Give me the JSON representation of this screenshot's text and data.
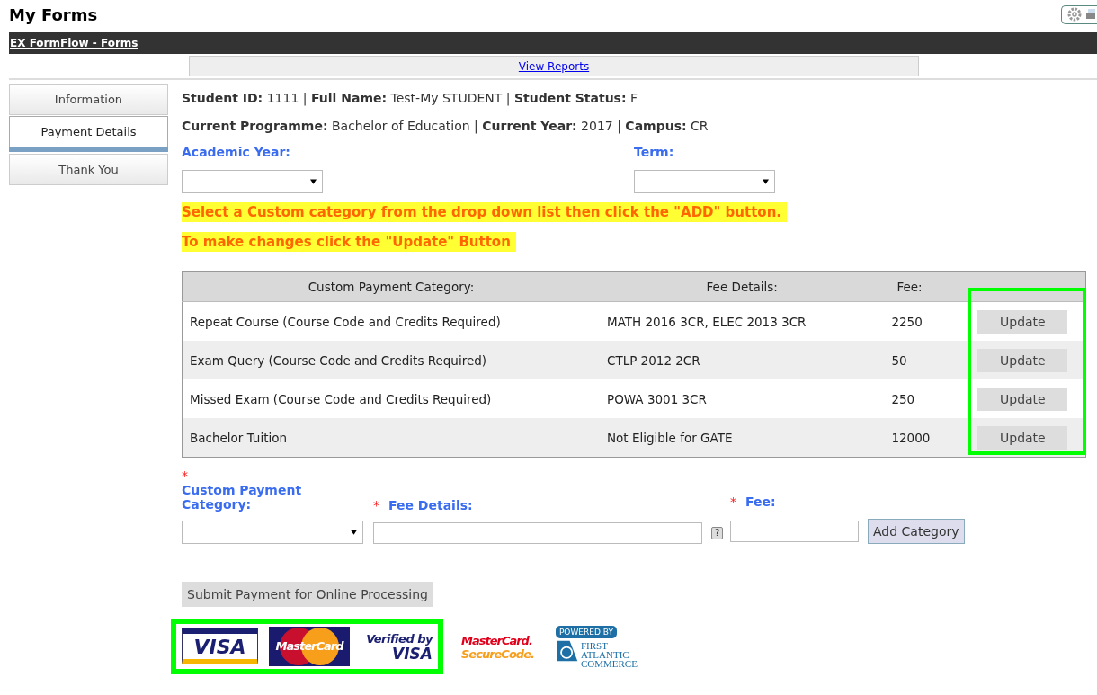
{
  "page_title": "My Forms",
  "nav_bar": {
    "link": "EX FormFlow - Forms"
  },
  "sub_bar": {
    "link": "View Reports"
  },
  "sidebar_tabs": [
    {
      "label": "Information",
      "selected": false
    },
    {
      "label": "Payment Details",
      "selected": true
    },
    {
      "label": "Thank You",
      "selected": false
    }
  ],
  "student_info": [
    "**Student ID:** 1111 | **Full Name:** Test-My STUDENT | **Student Status:** F",
    "**Current Programme:** Bachelor of Education | **Current Year:** 2017 | **Campus:** CR"
  ],
  "filters": [
    {
      "label": "Academic Year:"
    },
    {
      "label": "Term:"
    }
  ],
  "instructions": [
    "Select a Custom category from the drop down list then click the \"ADD\" button.",
    "To make changes click the \"Update\" Button"
  ],
  "table": {
    "columns": [
      "Custom Payment Category:",
      "Fee Details:",
      "Fee:"
    ],
    "rows": [
      {
        "category": "Repeat Course (Course Code and Credits Required)",
        "details": "MATH 2016 3CR, ELEC 2013 3CR",
        "fee": "2250",
        "action": "Update"
      },
      {
        "category": "Exam Query (Course Code and Credits Required)",
        "details": "CTLP 2012 2CR",
        "fee": "50",
        "action": "Update"
      },
      {
        "category": "Missed Exam (Course Code and Credits Required)",
        "details": "POWA 3001 3CR",
        "fee": "250",
        "action": "Update"
      },
      {
        "category": "Bachelor Tuition",
        "details": "Not Eligible for GATE",
        "fee": "12000",
        "action": "Update"
      }
    ]
  },
  "add_form": {
    "required_mark": "*",
    "category_label": "Custom Payment Category:",
    "details_label": "Fee Details:",
    "fee_label": "Fee:",
    "help": "?",
    "button": "Add Category"
  },
  "submit_button": "Submit Payment for Online Processing",
  "logos": [
    {
      "kind": "visa",
      "texts": [
        "VISA"
      ]
    },
    {
      "kind": "mastercard",
      "texts": [
        "MasterCard"
      ]
    },
    {
      "kind": "verified",
      "texts": [
        "Verified by",
        "VISA"
      ]
    },
    {
      "kind": "securecode",
      "texts": [
        "MasterCard.",
        "SecureCode."
      ]
    },
    {
      "kind": "fac",
      "texts": [
        "POWERED BY",
        "FIRST",
        "ATLANTIC",
        "COMMERCE"
      ]
    }
  ]
}
